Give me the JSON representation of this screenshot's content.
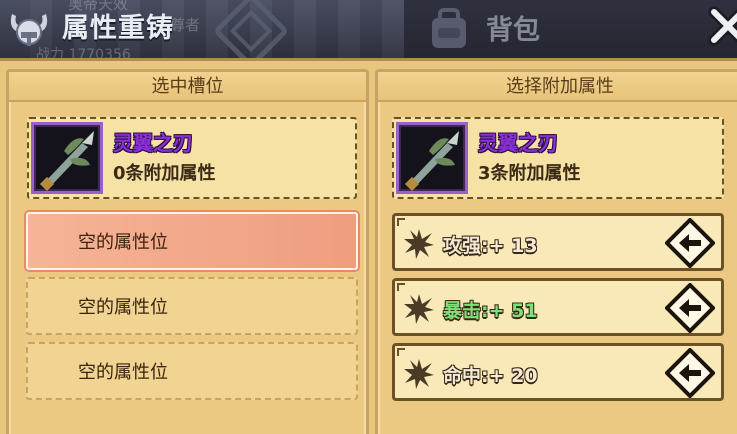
{
  "header": {
    "title": "属性重铸",
    "faint_name": "奥帝天效",
    "faint_role": "尊者",
    "faint_power": "战力  1770356",
    "bag_label": "背包"
  },
  "left_panel": {
    "heading": "选中槽位",
    "item": {
      "name": "灵翼之刃",
      "subtitle": "0条附加属性"
    },
    "slots": [
      {
        "label": "空的属性位",
        "selected": true
      },
      {
        "label": "空的属性位",
        "selected": false
      },
      {
        "label": "空的属性位",
        "selected": false
      }
    ]
  },
  "right_panel": {
    "heading": "选择附加属性",
    "item": {
      "name": "灵翼之刃",
      "subtitle": "3条附加属性"
    },
    "attributes": [
      {
        "text": "攻强:+ 13",
        "color": "#f3ead8"
      },
      {
        "text": "暴击:+ 51",
        "color": "#7fe07a"
      },
      {
        "text": "命中:+ 20",
        "color": "#f3ead8"
      }
    ]
  },
  "colors": {
    "rarity_purple": "#8c2fd6",
    "selected_slot": "#f6b496",
    "panel_bg": "#ebc982"
  },
  "icons": [
    "horn-helmet-icon",
    "bag-icon",
    "close-icon",
    "sword-icon",
    "burst-icon",
    "arrow-left-icon"
  ]
}
